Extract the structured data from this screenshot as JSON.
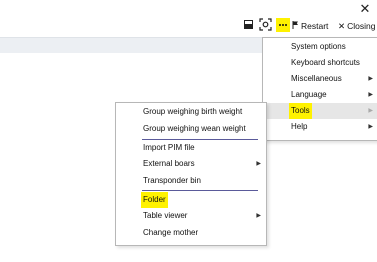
{
  "window": {
    "close_glyph": "✕"
  },
  "toolbar": {
    "restart_label": "Restart",
    "closing_label": "Closing",
    "restart_icon": "flag-icon",
    "closing_icon": "x-icon",
    "highlight_color": "#fff200"
  },
  "main_menu": {
    "items": [
      {
        "label": "System options",
        "submenu": false
      },
      {
        "label": "Keyboard shortcuts",
        "submenu": false
      },
      {
        "label": "Miscellaneous",
        "submenu": true
      },
      {
        "label": "Language",
        "submenu": true
      },
      {
        "label": "Tools",
        "submenu": true,
        "highlighted": true,
        "active": true
      },
      {
        "label": "Help",
        "submenu": true
      }
    ]
  },
  "tools_menu": {
    "items": [
      {
        "label": "Group weighing birth weight",
        "submenu": false
      },
      {
        "label": "Group weighing wean weight",
        "submenu": false
      },
      {
        "label": "Import PIM file",
        "submenu": false
      },
      {
        "label": "External boars",
        "submenu": true
      },
      {
        "label": "Transponder bin",
        "submenu": false
      },
      {
        "label": "Folder",
        "submenu": false,
        "highlighted": true
      },
      {
        "label": "Table viewer",
        "submenu": true
      },
      {
        "label": "Change mother",
        "submenu": false
      }
    ]
  }
}
